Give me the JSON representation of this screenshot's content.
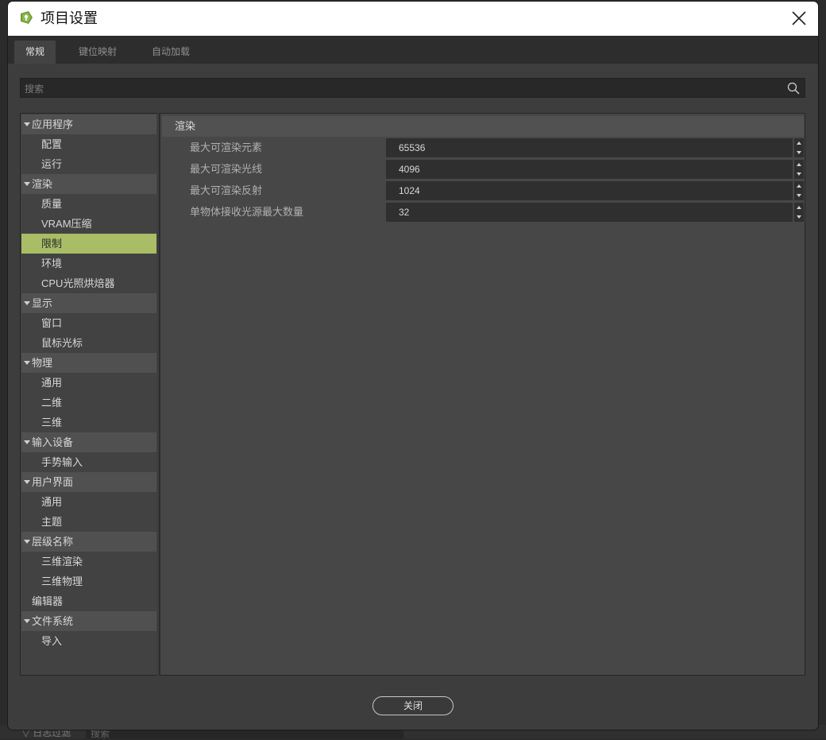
{
  "window": {
    "title": "项目设置"
  },
  "tabs": [
    {
      "label": "常规",
      "active": true
    },
    {
      "label": "键位映射",
      "active": false
    },
    {
      "label": "自动加载",
      "active": false
    }
  ],
  "search": {
    "placeholder": "搜索"
  },
  "sidebar": {
    "items": [
      {
        "label": "应用程序",
        "kind": "category"
      },
      {
        "label": "配置",
        "kind": "child"
      },
      {
        "label": "运行",
        "kind": "child"
      },
      {
        "label": "渲染",
        "kind": "category"
      },
      {
        "label": "质量",
        "kind": "child"
      },
      {
        "label": "VRAM压缩",
        "kind": "child"
      },
      {
        "label": "限制",
        "kind": "child",
        "selected": true
      },
      {
        "label": "环境",
        "kind": "child"
      },
      {
        "label": "CPU光照烘焙器",
        "kind": "child"
      },
      {
        "label": "显示",
        "kind": "category"
      },
      {
        "label": "窗口",
        "kind": "child"
      },
      {
        "label": "鼠标光标",
        "kind": "child"
      },
      {
        "label": "物理",
        "kind": "category"
      },
      {
        "label": "通用",
        "kind": "child"
      },
      {
        "label": "二维",
        "kind": "child"
      },
      {
        "label": "三维",
        "kind": "child"
      },
      {
        "label": "输入设备",
        "kind": "category"
      },
      {
        "label": "手势输入",
        "kind": "child"
      },
      {
        "label": "用户界面",
        "kind": "category"
      },
      {
        "label": "通用",
        "kind": "child"
      },
      {
        "label": "主题",
        "kind": "child"
      },
      {
        "label": "层级名称",
        "kind": "category"
      },
      {
        "label": "三维渲染",
        "kind": "child"
      },
      {
        "label": "三维物理",
        "kind": "child"
      },
      {
        "label": "编辑器",
        "kind": "leaf"
      },
      {
        "label": "文件系统",
        "kind": "category"
      },
      {
        "label": "导入",
        "kind": "child"
      }
    ]
  },
  "panel": {
    "section": "渲染",
    "properties": [
      {
        "label": "最大可渲染元素",
        "value": "65536"
      },
      {
        "label": "最大可渲染光线",
        "value": "4096"
      },
      {
        "label": "最大可渲染反射",
        "value": "1024"
      },
      {
        "label": "单物体接收光源最大数量",
        "value": "32"
      }
    ]
  },
  "footer": {
    "close_label": "关闭"
  },
  "background": {
    "filter_label": "日志过滤",
    "filter_placeholder": "搜索"
  },
  "colors": {
    "accent_selected": "#a8bd66",
    "dialog_bg": "#3d3d3d",
    "titlebar_bg": "#ffffff"
  }
}
